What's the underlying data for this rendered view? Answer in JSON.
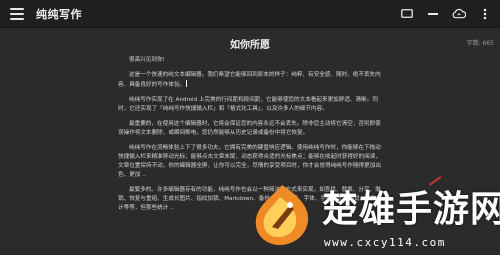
{
  "app": {
    "title": "纯纯写作"
  },
  "toolbar": {
    "icons": [
      "tablet-icon",
      "minus-icon",
      "cloud-sync-icon",
      "more-vert-icon"
    ]
  },
  "document": {
    "title": "如你所愿",
    "word_count": "字数: 665",
    "greeting": "很高兴见到你!",
    "paragraphs": [
      "这是一个快速的纯文本编辑器。我们希望它能够回到原本的样子：纯粹、有安全感、随时、绝不丢失内容、具备良好的写作体验。",
      "纯纯写作实现了在 Android 上完美的行间距和段间距，它能够使您的文本看起来更加舒适、清晰。同时，它还实现了「纯纯写作快捷输入栏」和「格式化工具」，以及许多人的细节内容。",
      "最重要的，在使用这个编辑器时，它将会保证您的内容永远不会丢失。除非您主动将它清空，否则即使误操作将文本删除、或瞬间断电，您仍然能够从历史记录或备份中将它恢复。",
      "纯纯写作在流畅体验上下了很多功夫，它拥有完美的键盘响应逻辑。使用纯纯写作时，你能够在下拖动快捷输入栏来精准移动光标；能够点击文章末尾，动态获得合适的光标焦点；能够在收起时获得好的阅读，文章位置保持不动，你的编辑器全屏、让你可以完全，尽情的享受项目时，你才会觉得纯纯写作随得更加出色、更加 ..",
      "最繁多的。许多编辑器存有的功能，纯纯写作也会以一种简洁的方式来实现。如查找、替换、分享、撤销、恢复与重组、生成长图片、指纹加锁、Markdown、备份、夜间模式、字体、手机模式、撤销、字数统计等等，但那些统计 .."
    ]
  },
  "watermark": {
    "site_name": "楚雄手游网",
    "url": "www.cxcy114.com"
  },
  "colors": {
    "background": "#2b2b2b",
    "topbar": "#1f1f1f",
    "text": "#d6d6d6",
    "accent_red": "#c0392b",
    "logo_orange": "#f08a24"
  }
}
